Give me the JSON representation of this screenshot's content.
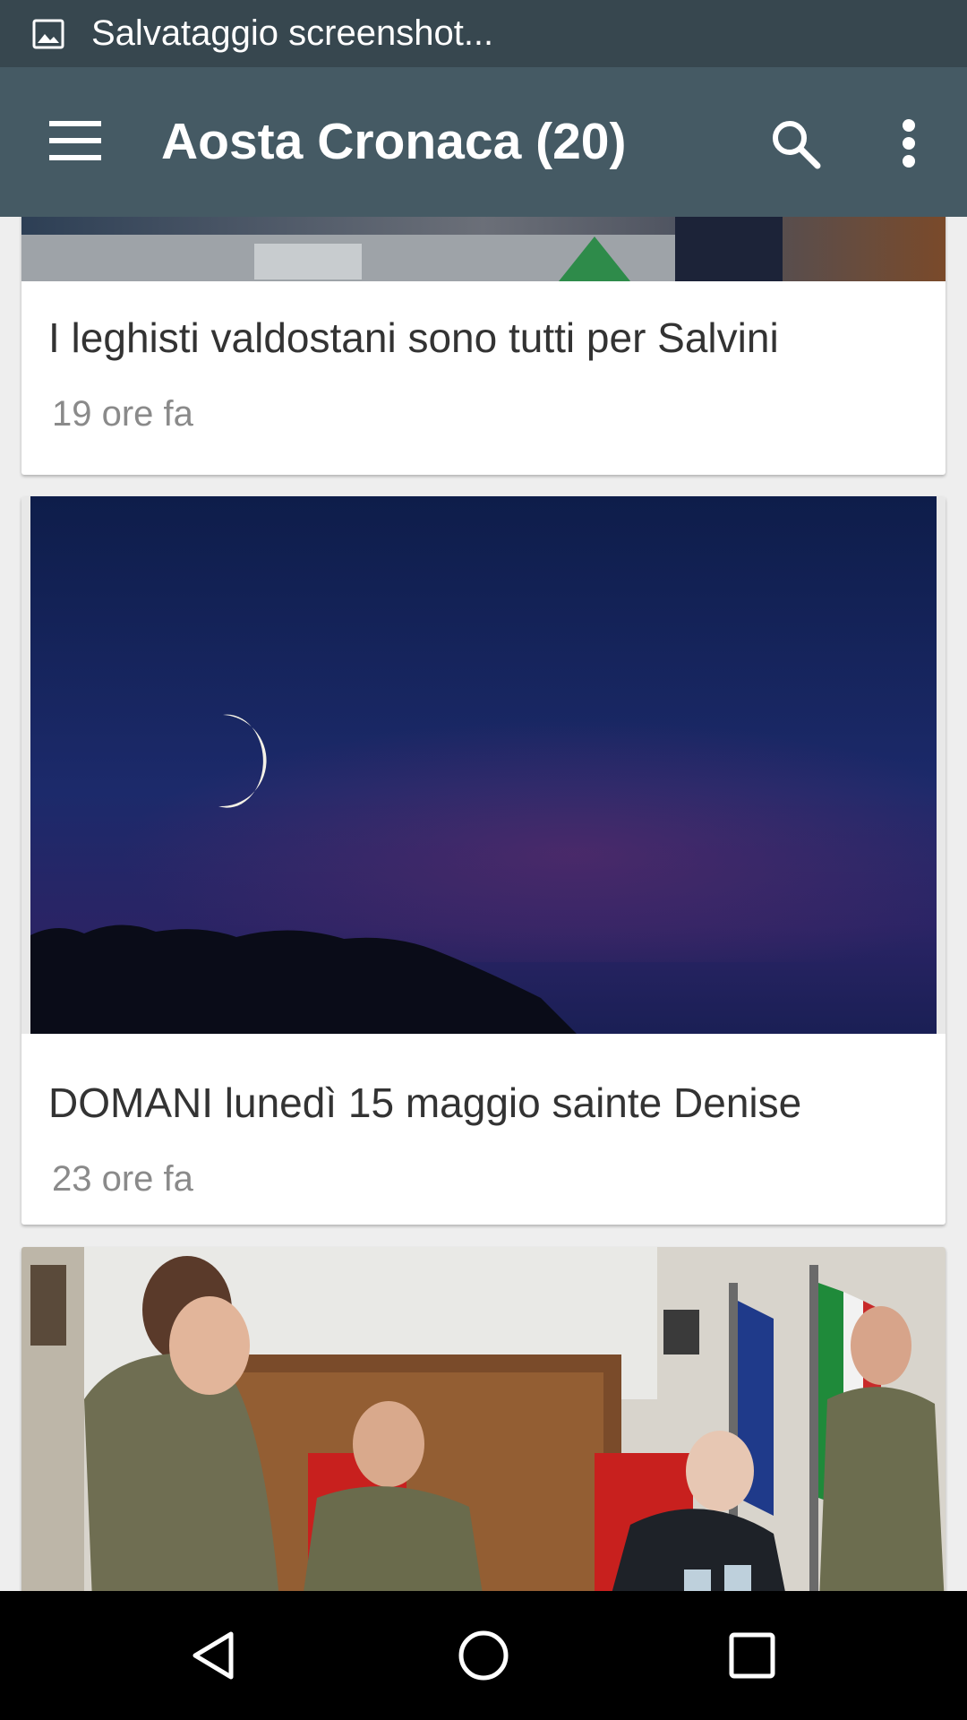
{
  "status_bar": {
    "text": "Salvataggio screenshot...",
    "icon": "image-icon"
  },
  "app_bar": {
    "title": "Aosta Cronaca (20)",
    "icons": [
      "menu-icon",
      "search-icon",
      "more-vert-icon"
    ],
    "color": "#455a64"
  },
  "articles": [
    {
      "title": "I leghisti valdostani sono tutti per Salvini",
      "time": "19 ore fa",
      "image": "ballot-box-photo"
    },
    {
      "title": "DOMANI lunedì 15 maggio sainte Denise",
      "time": "23 ore fa",
      "image": "crescent-moon-night-sky-photo"
    },
    {
      "title": "",
      "time": "",
      "image": "military-signing-ceremony-photo"
    }
  ],
  "nav_bar": {
    "icons": [
      "back-icon",
      "home-icon",
      "recents-icon"
    ]
  }
}
